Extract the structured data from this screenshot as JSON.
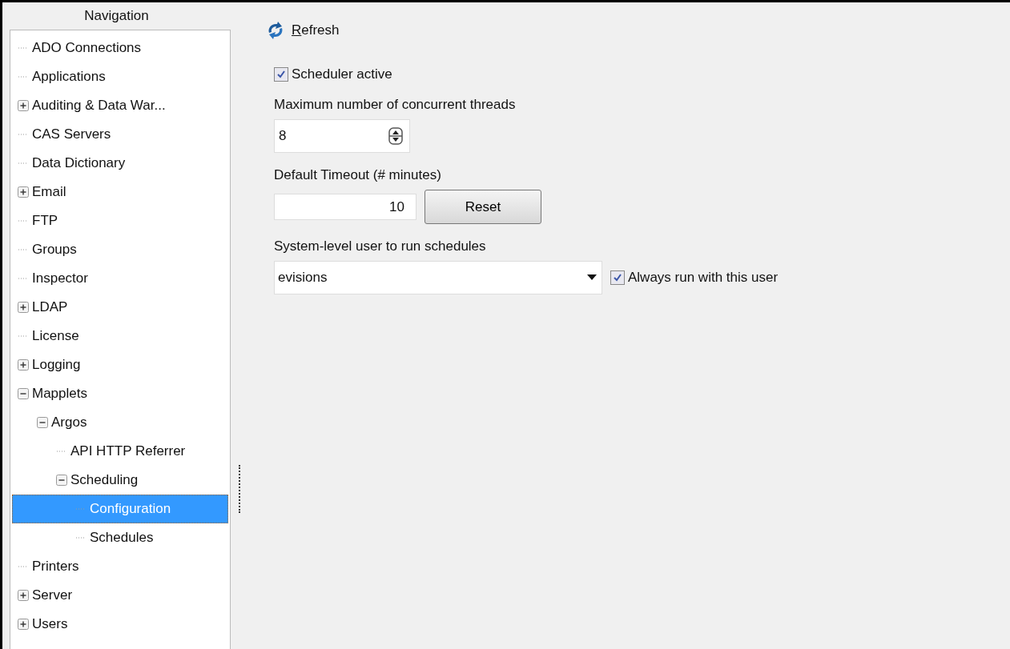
{
  "navigation": {
    "title": "Navigation",
    "items": [
      {
        "label": "ADO Connections",
        "kind": "leaf",
        "selected": false
      },
      {
        "label": "Applications",
        "kind": "leaf",
        "selected": false
      },
      {
        "label": "Auditing & Data War...",
        "kind": "group",
        "expanded": false,
        "selected": false
      },
      {
        "label": "CAS Servers",
        "kind": "leaf",
        "selected": false
      },
      {
        "label": "Data Dictionary",
        "kind": "leaf",
        "selected": false
      },
      {
        "label": "Email",
        "kind": "group",
        "expanded": false,
        "selected": false
      },
      {
        "label": "FTP",
        "kind": "leaf",
        "selected": false
      },
      {
        "label": "Groups",
        "kind": "leaf",
        "selected": false
      },
      {
        "label": "Inspector",
        "kind": "leaf",
        "selected": false
      },
      {
        "label": "LDAP",
        "kind": "group",
        "expanded": false,
        "selected": false
      },
      {
        "label": "License",
        "kind": "leaf",
        "selected": false
      },
      {
        "label": "Logging",
        "kind": "group",
        "expanded": false,
        "selected": false
      },
      {
        "label": "Mapplets",
        "kind": "group",
        "expanded": true,
        "selected": false,
        "children": [
          {
            "label": "Argos",
            "kind": "group",
            "expanded": true,
            "selected": false,
            "children": [
              {
                "label": "API HTTP Referrer",
                "kind": "leaf",
                "selected": false
              },
              {
                "label": "Scheduling",
                "kind": "group",
                "expanded": true,
                "selected": false,
                "children": [
                  {
                    "label": "Configuration",
                    "kind": "leaf",
                    "selected": true
                  },
                  {
                    "label": "Schedules",
                    "kind": "leaf",
                    "selected": false
                  }
                ]
              }
            ]
          }
        ]
      },
      {
        "label": "Printers",
        "kind": "leaf",
        "selected": false
      },
      {
        "label": "Server",
        "kind": "group",
        "expanded": false,
        "selected": false
      },
      {
        "label": "Users",
        "kind": "group",
        "expanded": false,
        "selected": false
      }
    ]
  },
  "toolbar": {
    "refresh": "Refresh"
  },
  "settings": {
    "scheduler_active": {
      "label": "Scheduler active",
      "checked": true
    },
    "max_threads": {
      "label": "Maximum number of concurrent threads",
      "value": "8"
    },
    "timeout": {
      "label": "Default Timeout (# minutes)",
      "value": "10",
      "button": "Reset"
    },
    "system_user": {
      "label": "System-level user to run schedules",
      "value": "evisions"
    },
    "always_run": {
      "label": "Always run with this user",
      "checked": true
    }
  }
}
